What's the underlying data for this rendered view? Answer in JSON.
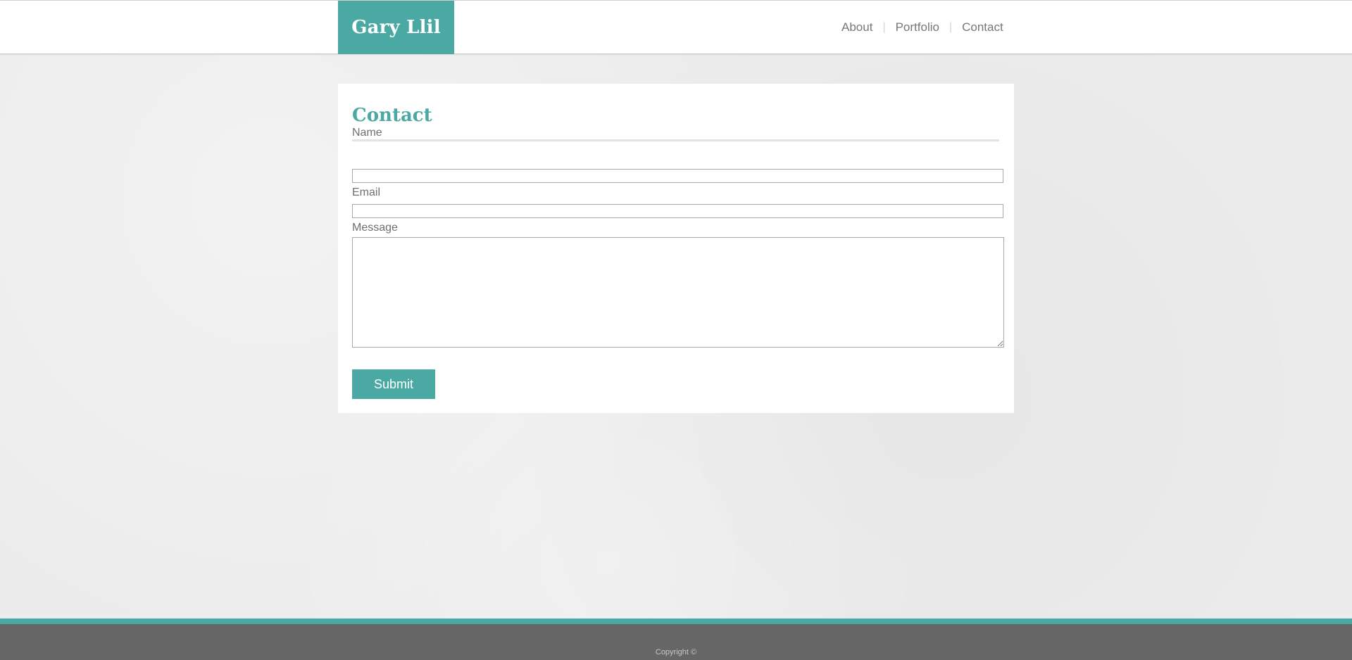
{
  "header": {
    "logo_text": "Gary Llil",
    "nav": [
      {
        "label": "About"
      },
      {
        "label": "Portfolio"
      },
      {
        "label": "Contact"
      }
    ],
    "separator": "|"
  },
  "main": {
    "title": "Contact",
    "form": {
      "name_label": "Name",
      "name_value": "",
      "email_label": "Email",
      "email_value": "",
      "message_label": "Message",
      "message_value": "",
      "submit_label": "Submit"
    }
  },
  "footer": {
    "copyright": "Copyright ©"
  },
  "colors": {
    "accent": "#4aa9a3",
    "footer_bg": "#666666",
    "page_bg": "#ececec",
    "text_gray": "#777777"
  }
}
